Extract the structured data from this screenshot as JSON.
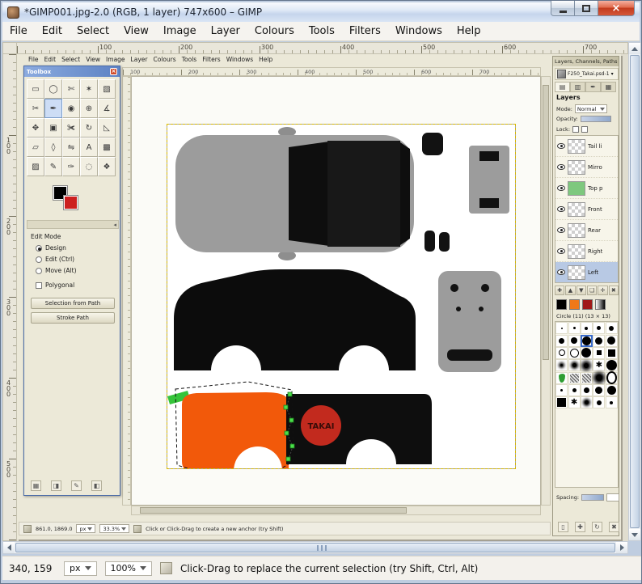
{
  "window": {
    "title": "*GIMP001.jpg-2.0 (RGB, 1 layer) 747x600 – GIMP",
    "close_glyph": "×"
  },
  "menubar": {
    "items": [
      "File",
      "Edit",
      "Select",
      "View",
      "Image",
      "Layer",
      "Colours",
      "Tools",
      "Filters",
      "Windows",
      "Help"
    ]
  },
  "ruler": {
    "h": [
      "100",
      "200",
      "300",
      "400",
      "500",
      "600",
      "700"
    ],
    "v": [
      "100",
      "200",
      "300",
      "400",
      "500"
    ]
  },
  "statusbar": {
    "coords": "340, 159",
    "unit": "px",
    "zoom": "100%",
    "message": "Click-Drag to replace the current selection (try Shift, Ctrl, Alt)"
  },
  "colors": {
    "car_orange": "#f2590a",
    "logo_red": "#c22a1e",
    "toolbox_titlebar_blue": "#5d82c4",
    "layer_boundary_yellow": "#d8b800"
  },
  "nested": {
    "menubar": {
      "items": [
        "File",
        "Edit",
        "Select",
        "View",
        "Image",
        "Layer",
        "Colours",
        "Tools",
        "Filters",
        "Windows",
        "Help"
      ]
    },
    "ruler_h": [
      "100",
      "200",
      "300",
      "400",
      "500",
      "600",
      "700"
    ],
    "toolbox": {
      "title": "Toolbox",
      "close_glyph": "×",
      "tools": [
        "▭",
        "◯",
        "✄",
        "✶",
        "▧",
        "✂",
        "✒",
        "◉",
        "⊕",
        "∡",
        "✥",
        "▣",
        "✀",
        "↻",
        "◺",
        "▱",
        "◊",
        "⇋",
        "A",
        "▩",
        "▨",
        "✎",
        "✑",
        "◌",
        "❖"
      ],
      "collapse_glyph": "◂",
      "edit_mode_label": "Edit Mode",
      "modes": [
        "Design",
        "Edit (Ctrl)",
        "Move (Alt)"
      ],
      "selected_mode": "Design",
      "polygonal_label": "Polygonal",
      "selection_from_path": "Selection from Path",
      "stroke_path": "Stroke Path",
      "footer_icons": [
        "▦",
        "◨",
        "✎",
        "◧"
      ]
    },
    "dock": {
      "title": "Layers, Channels, Paths",
      "close_glyph": "×",
      "tab_label": "F250_Takai.psd-1",
      "tab_menu_glyph": "▾",
      "tabs": [
        "▤",
        "▥",
        "✒",
        "▦"
      ],
      "layers_label": "Layers",
      "mode_label": "Mode:",
      "mode_value": "Normal",
      "opacity_label": "Opacity:",
      "lock_label": "Lock:",
      "layers": [
        "Tail li",
        "Mirro",
        "Top p",
        "Front",
        "Rear",
        "Right",
        "Left"
      ],
      "layer_buttons": [
        "✚",
        "▲",
        "▼",
        "❏",
        "✛",
        "✖"
      ],
      "brush_name": "Circle (11) (13 × 13)",
      "spacing_label": "Spacing:",
      "footer_icons": [
        "▯",
        "✚",
        "↻",
        "✖"
      ]
    },
    "statusbar": {
      "coords": "861.0, 1869.0",
      "unit": "px",
      "zoom": "33.3%",
      "message": "Click or Click-Drag to create a new anchor (try Shift)"
    },
    "canvas": {
      "logo_text": "TAKAI"
    }
  }
}
